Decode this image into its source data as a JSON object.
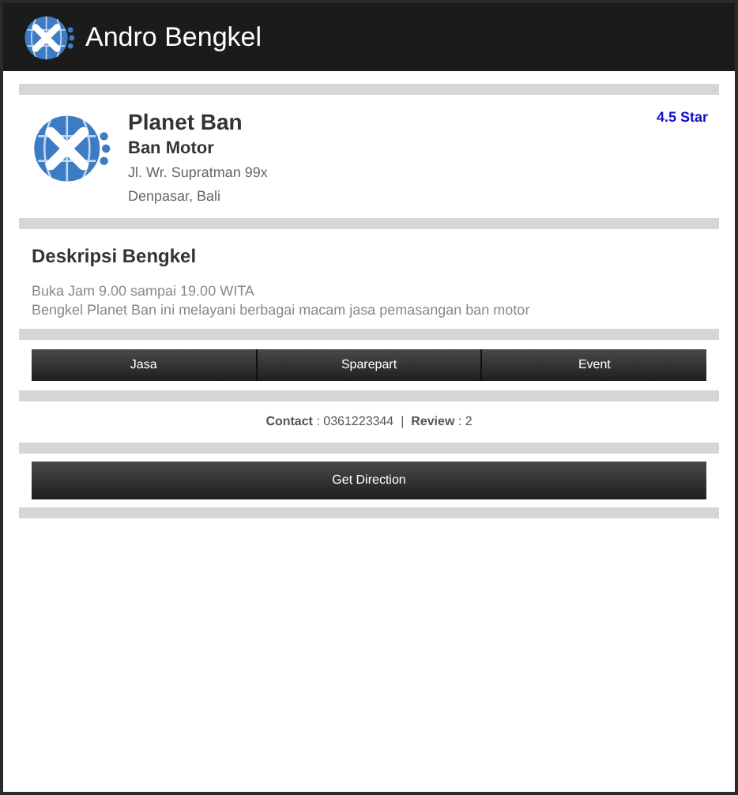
{
  "app_bar": {
    "title": "Andro Bengkel"
  },
  "shop": {
    "name": "Planet Ban",
    "category": "Ban Motor",
    "address_line_1": "Jl. Wr. Supratman 99x",
    "address_line_2": "Denpasar, Bali",
    "rating": "4.5 Star"
  },
  "description": {
    "heading": "Deskripsi Bengkel",
    "lines": [
      "Buka Jam 9.00 sampai 19.00 WITA",
      "Bengkel Planet Ban ini melayani berbagai macam jasa pemasangan ban motor"
    ]
  },
  "tabs": [
    {
      "label": "Jasa"
    },
    {
      "label": "Sparepart"
    },
    {
      "label": "Event"
    }
  ],
  "contact_line": "**Contact** : 0361223344  |  **Review** : 2",
  "direction_button": "Get Direction"
}
